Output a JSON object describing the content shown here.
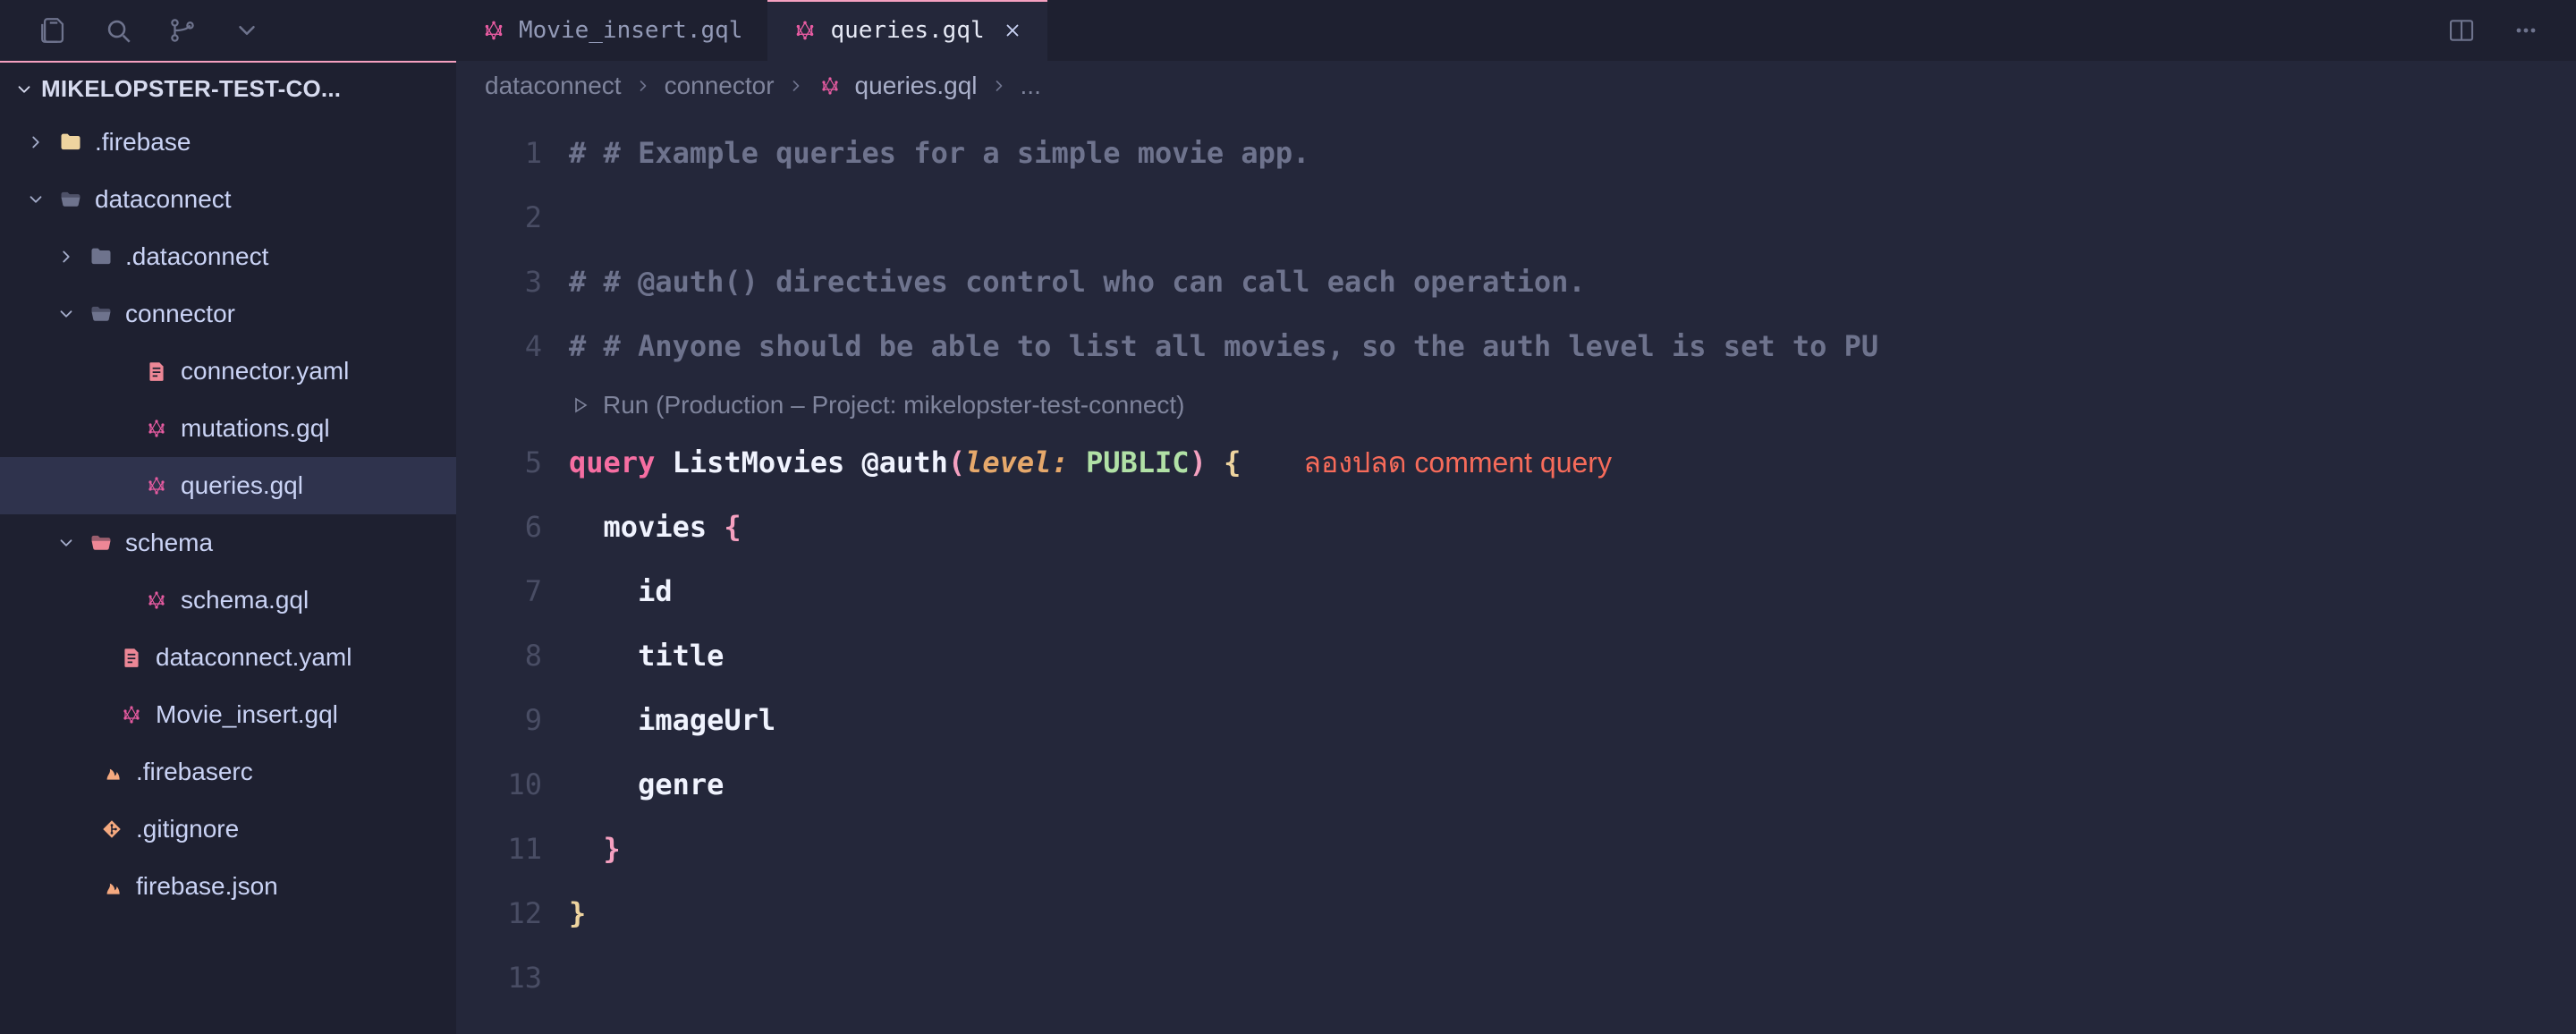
{
  "tabs": {
    "inactive_label": "Movie_insert.gql",
    "active_label": "queries.gql"
  },
  "titlebar_icons": {
    "explorer": "explorer-icon",
    "search": "search-icon",
    "scm": "source-control-icon",
    "more": "chevron-down-icon",
    "split": "split-editor-icon",
    "overflow": "more-icon"
  },
  "sidebar": {
    "project": "MIKELOPSTER-TEST-CO...",
    "tree": {
      "firebase_folder": ".firebase",
      "dataconnect_folder": "dataconnect",
      "dot_dataconnect": ".dataconnect",
      "connector_folder": "connector",
      "connector_yaml": "connector.yaml",
      "mutations_gql": "mutations.gql",
      "queries_gql": "queries.gql",
      "schema_folder": "schema",
      "schema_gql": "schema.gql",
      "dataconnect_yaml": "dataconnect.yaml",
      "movie_insert_gql": "Movie_insert.gql",
      "firebaserc": ".firebaserc",
      "gitignore": ".gitignore",
      "firebase_json": "firebase.json"
    }
  },
  "breadcrumbs": {
    "seg1": "dataconnect",
    "seg2": "connector",
    "seg3": "queries.gql",
    "ellipsis": "..."
  },
  "editor": {
    "line1": "# # Example queries for a simple movie app.",
    "line3": "# # @auth() directives control who can call each operation.",
    "line4": "# # Anyone should be able to list all movies, so the auth level is set to PU",
    "code_lens": "Run (Production – Project: mikelopster-test-connect)",
    "line5": {
      "kw": "query",
      "name": "ListMovies",
      "dec": "@auth",
      "argname": "level:",
      "argval": "PUBLIC",
      "open": "(",
      "close": ")",
      "brace": "{"
    },
    "annotation": "ลองปลด comment query",
    "line6_field": "movies",
    "line6_brace": "{",
    "line7": "id",
    "line8": "title",
    "line9": "imageUrl",
    "line10": "genre",
    "line11_brace": "}",
    "line12_brace": "}",
    "gutter": [
      "1",
      "2",
      "3",
      "4",
      "5",
      "6",
      "7",
      "8",
      "9",
      "10",
      "11",
      "12",
      "13"
    ]
  }
}
